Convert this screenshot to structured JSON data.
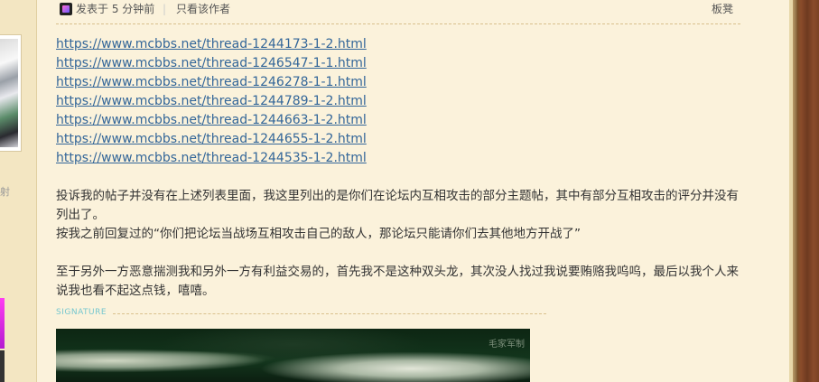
{
  "post": {
    "posted_time": "发表于 5 分钟前",
    "separator": "|",
    "only_author": "只看该作者",
    "floor": "板凳"
  },
  "links": [
    "https://www.mcbbs.net/thread-1244173-1-2.html",
    "https://www.mcbbs.net/thread-1246547-1-1.html",
    "https://www.mcbbs.net/thread-1246278-1-1.html",
    "https://www.mcbbs.net/thread-1244789-1-2.html",
    "https://www.mcbbs.net/thread-1244663-1-2.html",
    "https://www.mcbbs.net/thread-1244655-1-2.html",
    "https://www.mcbbs.net/thread-1244535-1-2.html"
  ],
  "body": {
    "p1": "投诉我的帖子并没有在上述列表里面，我这里列出的是你们在论坛内互相攻击的部分主题帖，其中有部分互相攻击的评分并没有列出了。",
    "p2": "按我之前回复过的“你们把论坛当战场互相攻击自己的敌人，那论坛只能请你们去其他地方开战了”",
    "p3": "至于另外一方恶意揣测我和另外一方有利益交易的，首先我不是这种双头龙，其次没人找过我说要贿赂我呜呜，最后以我个人来说我也看不起这点钱，嘻嘻。"
  },
  "signature": {
    "label": "SIGNATURE",
    "image_text": "毛家军制"
  },
  "sidebar": {
    "partial_char": "射"
  },
  "colors": {
    "background": "#fbf2db",
    "link": "#336699",
    "signature_label": "#75c7cf"
  }
}
